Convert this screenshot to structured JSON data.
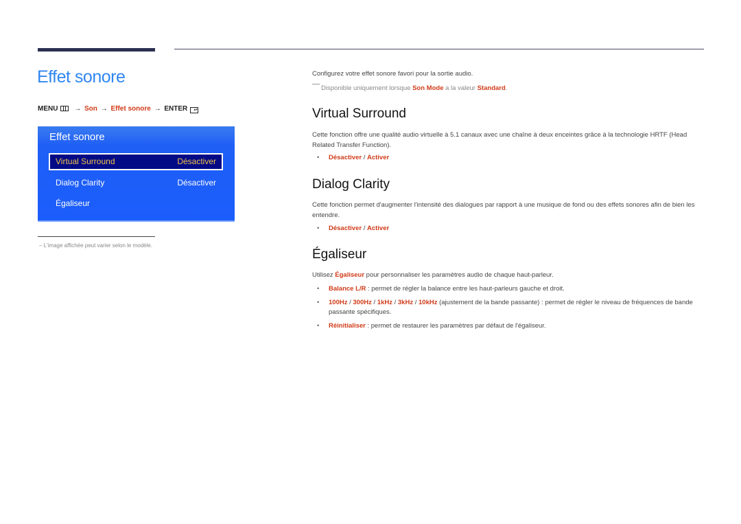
{
  "page": {
    "title": "Effet sonore",
    "menu_path": {
      "menu": "MENU",
      "arrow": "→",
      "son": "Son",
      "effet": "Effet sonore",
      "enter": "ENTER"
    },
    "note": "L'image affichée peut varier selon le modèle."
  },
  "osd": {
    "title": "Effet sonore",
    "rows": [
      {
        "label": "Virtual Surround",
        "value": "Désactiver",
        "selected": true
      },
      {
        "label": "Dialog Clarity",
        "value": "Désactiver",
        "selected": false
      },
      {
        "label": "Égaliseur",
        "value": "",
        "selected": false
      }
    ],
    "colors": {
      "panel": "#1b5dfc",
      "selected_bg": "#020a86",
      "selected_text": "#f3c24a"
    }
  },
  "content": {
    "intro": "Configurez votre effet sonore favori pour la sortie audio.",
    "avail": {
      "pre": "Disponible uniquement lorsque ",
      "son_mode": "Son Mode",
      "mid": " a la valeur ",
      "standard": "Standard",
      "end": "."
    },
    "sections": {
      "virtual_surround": {
        "heading": "Virtual Surround",
        "text": "Cette fonction offre une qualité audio virtuelle à 5.1 canaux avec une chaîne à deux enceintes grâce à la technologie HRTF (Head Related Transfer Function).",
        "opt1": "Désactiver",
        "sep": " / ",
        "opt2": "Activer"
      },
      "dialog_clarity": {
        "heading": "Dialog Clarity",
        "text": "Cette fonction permet d'augmenter l'intensité des dialogues par rapport à une musique de fond ou des effets sonores afin de bien les entendre.",
        "opt1": "Désactiver",
        "sep": " / ",
        "opt2": "Activer"
      },
      "egaliseur": {
        "heading": "Égaliseur",
        "text_pre": "Utilisez ",
        "text_term": "Égaliseur",
        "text_post": " pour personnaliser les paramètres audio de chaque haut-parleur.",
        "bullets": {
          "balance": {
            "term": "Balance L/R",
            "text": " : permet de régler la balance entre les haut-parleurs gauche et droit."
          },
          "bands": {
            "terms": [
              "100Hz",
              "300Hz",
              "1kHz",
              "3kHz",
              "10kHz"
            ],
            "sep": " / ",
            "text": " (ajustement de la bande passante) : permet de régler le niveau de fréquences de bande passante spécifiques."
          },
          "reset": {
            "term": "Réinitialiser",
            "text": " : permet de restaurer les paramètres par défaut de l'égaliseur."
          }
        }
      }
    },
    "bullet_glyph": "•",
    "accent_color": "#d03a18",
    "title_color": "#2f86f1"
  }
}
